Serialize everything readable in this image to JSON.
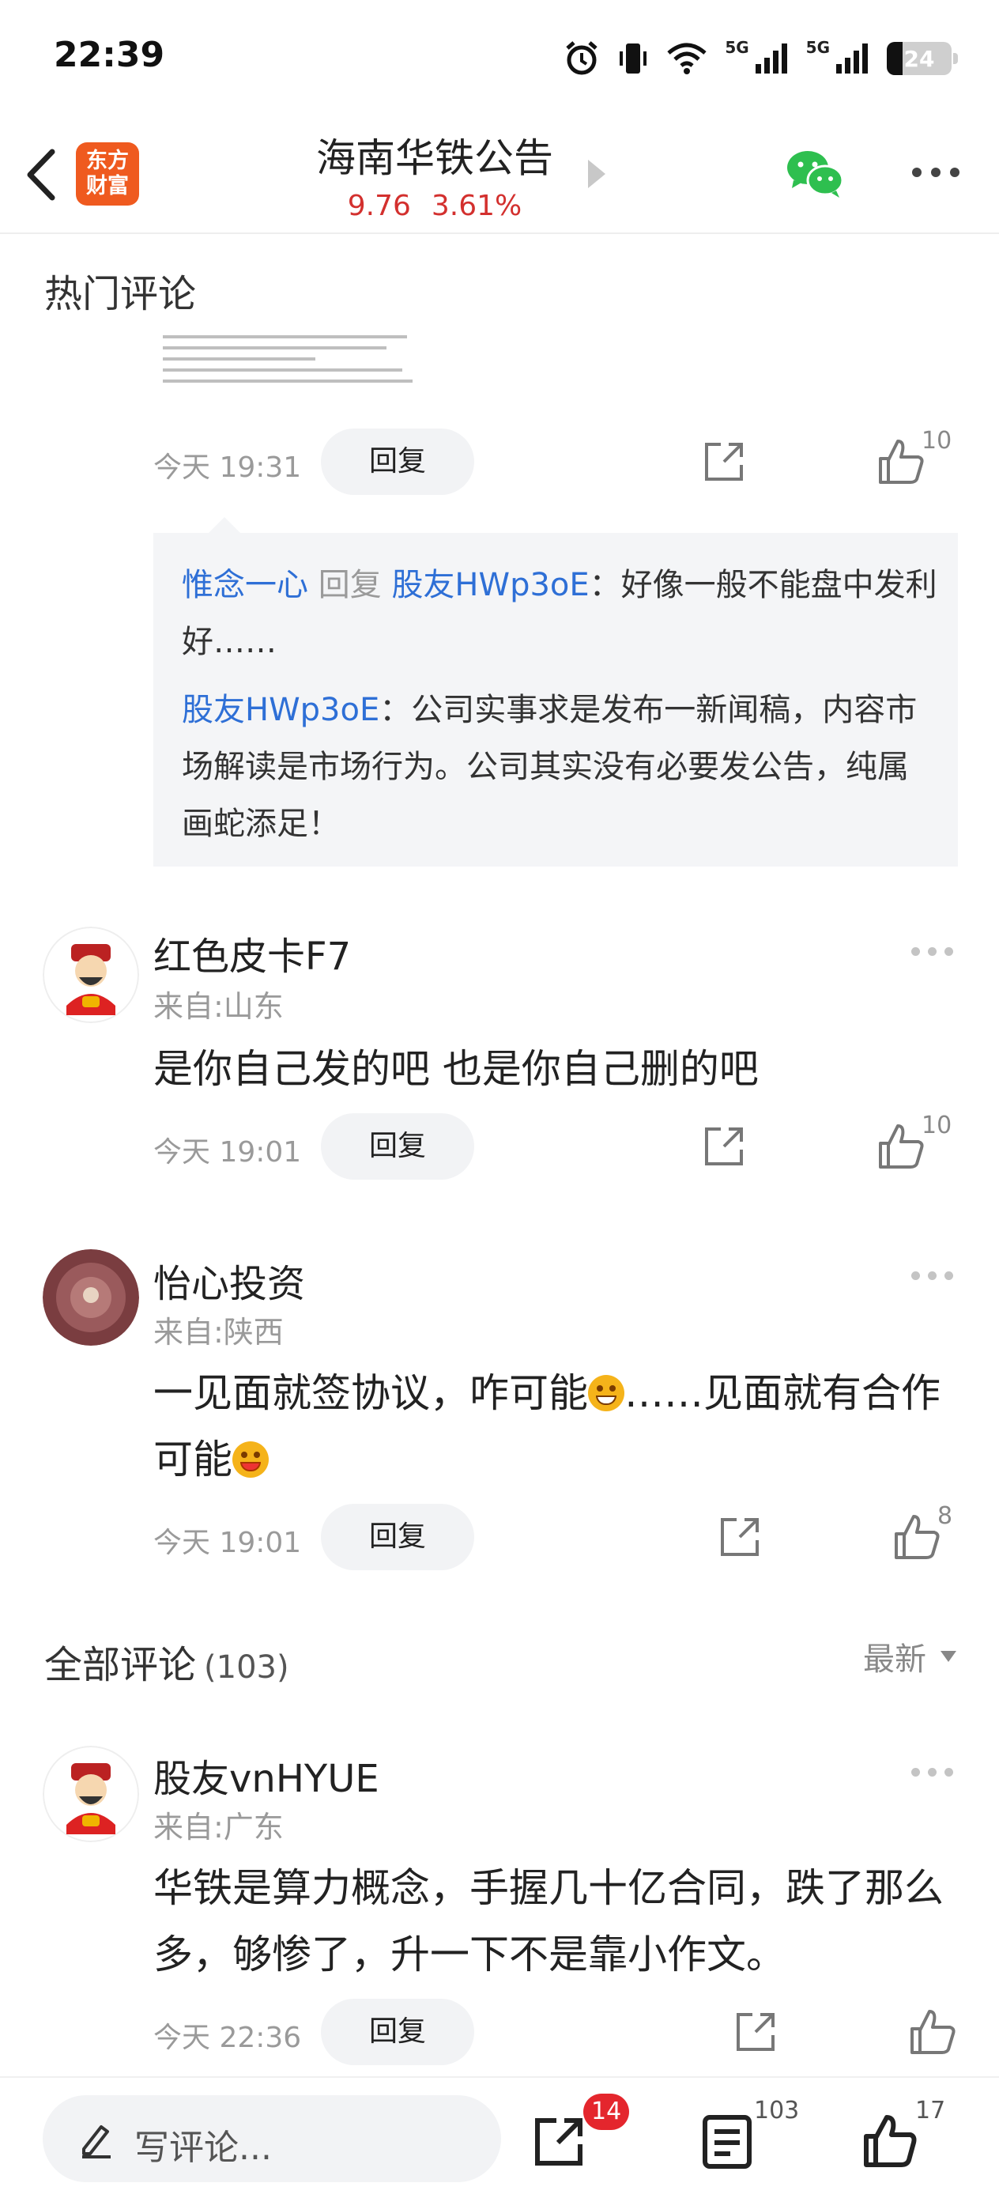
{
  "status_bar": {
    "time": "22:39",
    "network": "5G",
    "network2": "5G",
    "battery": "24"
  },
  "header": {
    "logo_text": "东方财富",
    "title": "海南华铁公告",
    "price": "9.76",
    "change": "3.61%"
  },
  "hot_section": {
    "title": "热门评论"
  },
  "post_actions": {
    "time": "今天 19:31",
    "reply": "回复",
    "likes": "10"
  },
  "reply_box": {
    "line1_user": "惟念一心",
    "line1_verb": "回复",
    "line1_target": "股友HWp3oE",
    "line1_text": "：好像一般不能盘中发利好……",
    "line2_user": "股友HWp3oE",
    "line2_text": "：公司实事求是发布一新闻稿，内容市场解读是市场行为。公司其实没有必要发公告，纯属画蛇添足！"
  },
  "comments": [
    {
      "name": "红色皮卡F7",
      "location": "来自:山东",
      "text": "是你自己发的吧 也是你自己删的吧",
      "time": "今天 19:01",
      "reply": "回复",
      "likes": "10"
    },
    {
      "name": "怡心投资",
      "location": "来自:陕西",
      "text_a": "一见面就签协议，咋可能",
      "text_b": "……见面就有合作可能",
      "time": "今天 19:01",
      "reply": "回复",
      "likes": "8"
    },
    {
      "name": "股友vnHYUE",
      "location": "来自:广东",
      "text": "华铁是算力概念，手握几十亿合同，跌了那么多，够惨了，升一下不是靠小作文。",
      "time": "今天 22:36",
      "reply": "回复",
      "likes": ""
    }
  ],
  "all_section": {
    "title": "全部评论",
    "count": "(103)",
    "sort": "最新"
  },
  "bottom_bar": {
    "placeholder": "写评论...",
    "share_badge": "14",
    "comments": "103",
    "likes": "17"
  },
  "colors": {
    "brand": "#ef5a1f",
    "up": "#d3302e",
    "link": "#2e6fd6",
    "badge": "#e4262d"
  }
}
